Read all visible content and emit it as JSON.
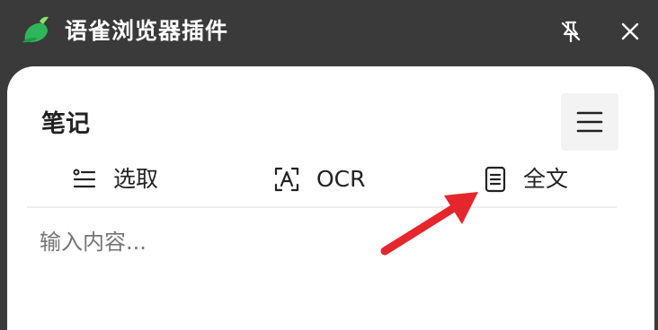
{
  "app": {
    "title": "语雀浏览器插件",
    "brand_color": "#3ec35e"
  },
  "window_controls": {
    "pin_icon": "unpin-icon",
    "close_icon": "close-icon"
  },
  "note": {
    "title": "笔记",
    "menu_icon": "hamburger-menu-icon",
    "tabs": [
      {
        "label": "选取",
        "icon": "select-list-icon"
      },
      {
        "label": "OCR",
        "icon": "ocr-scan-icon"
      },
      {
        "label": "全文",
        "icon": "document-icon"
      }
    ],
    "input_placeholder": "输入内容..."
  },
  "annotation": {
    "arrow_color": "#e5262c",
    "arrow_target": "全文"
  }
}
